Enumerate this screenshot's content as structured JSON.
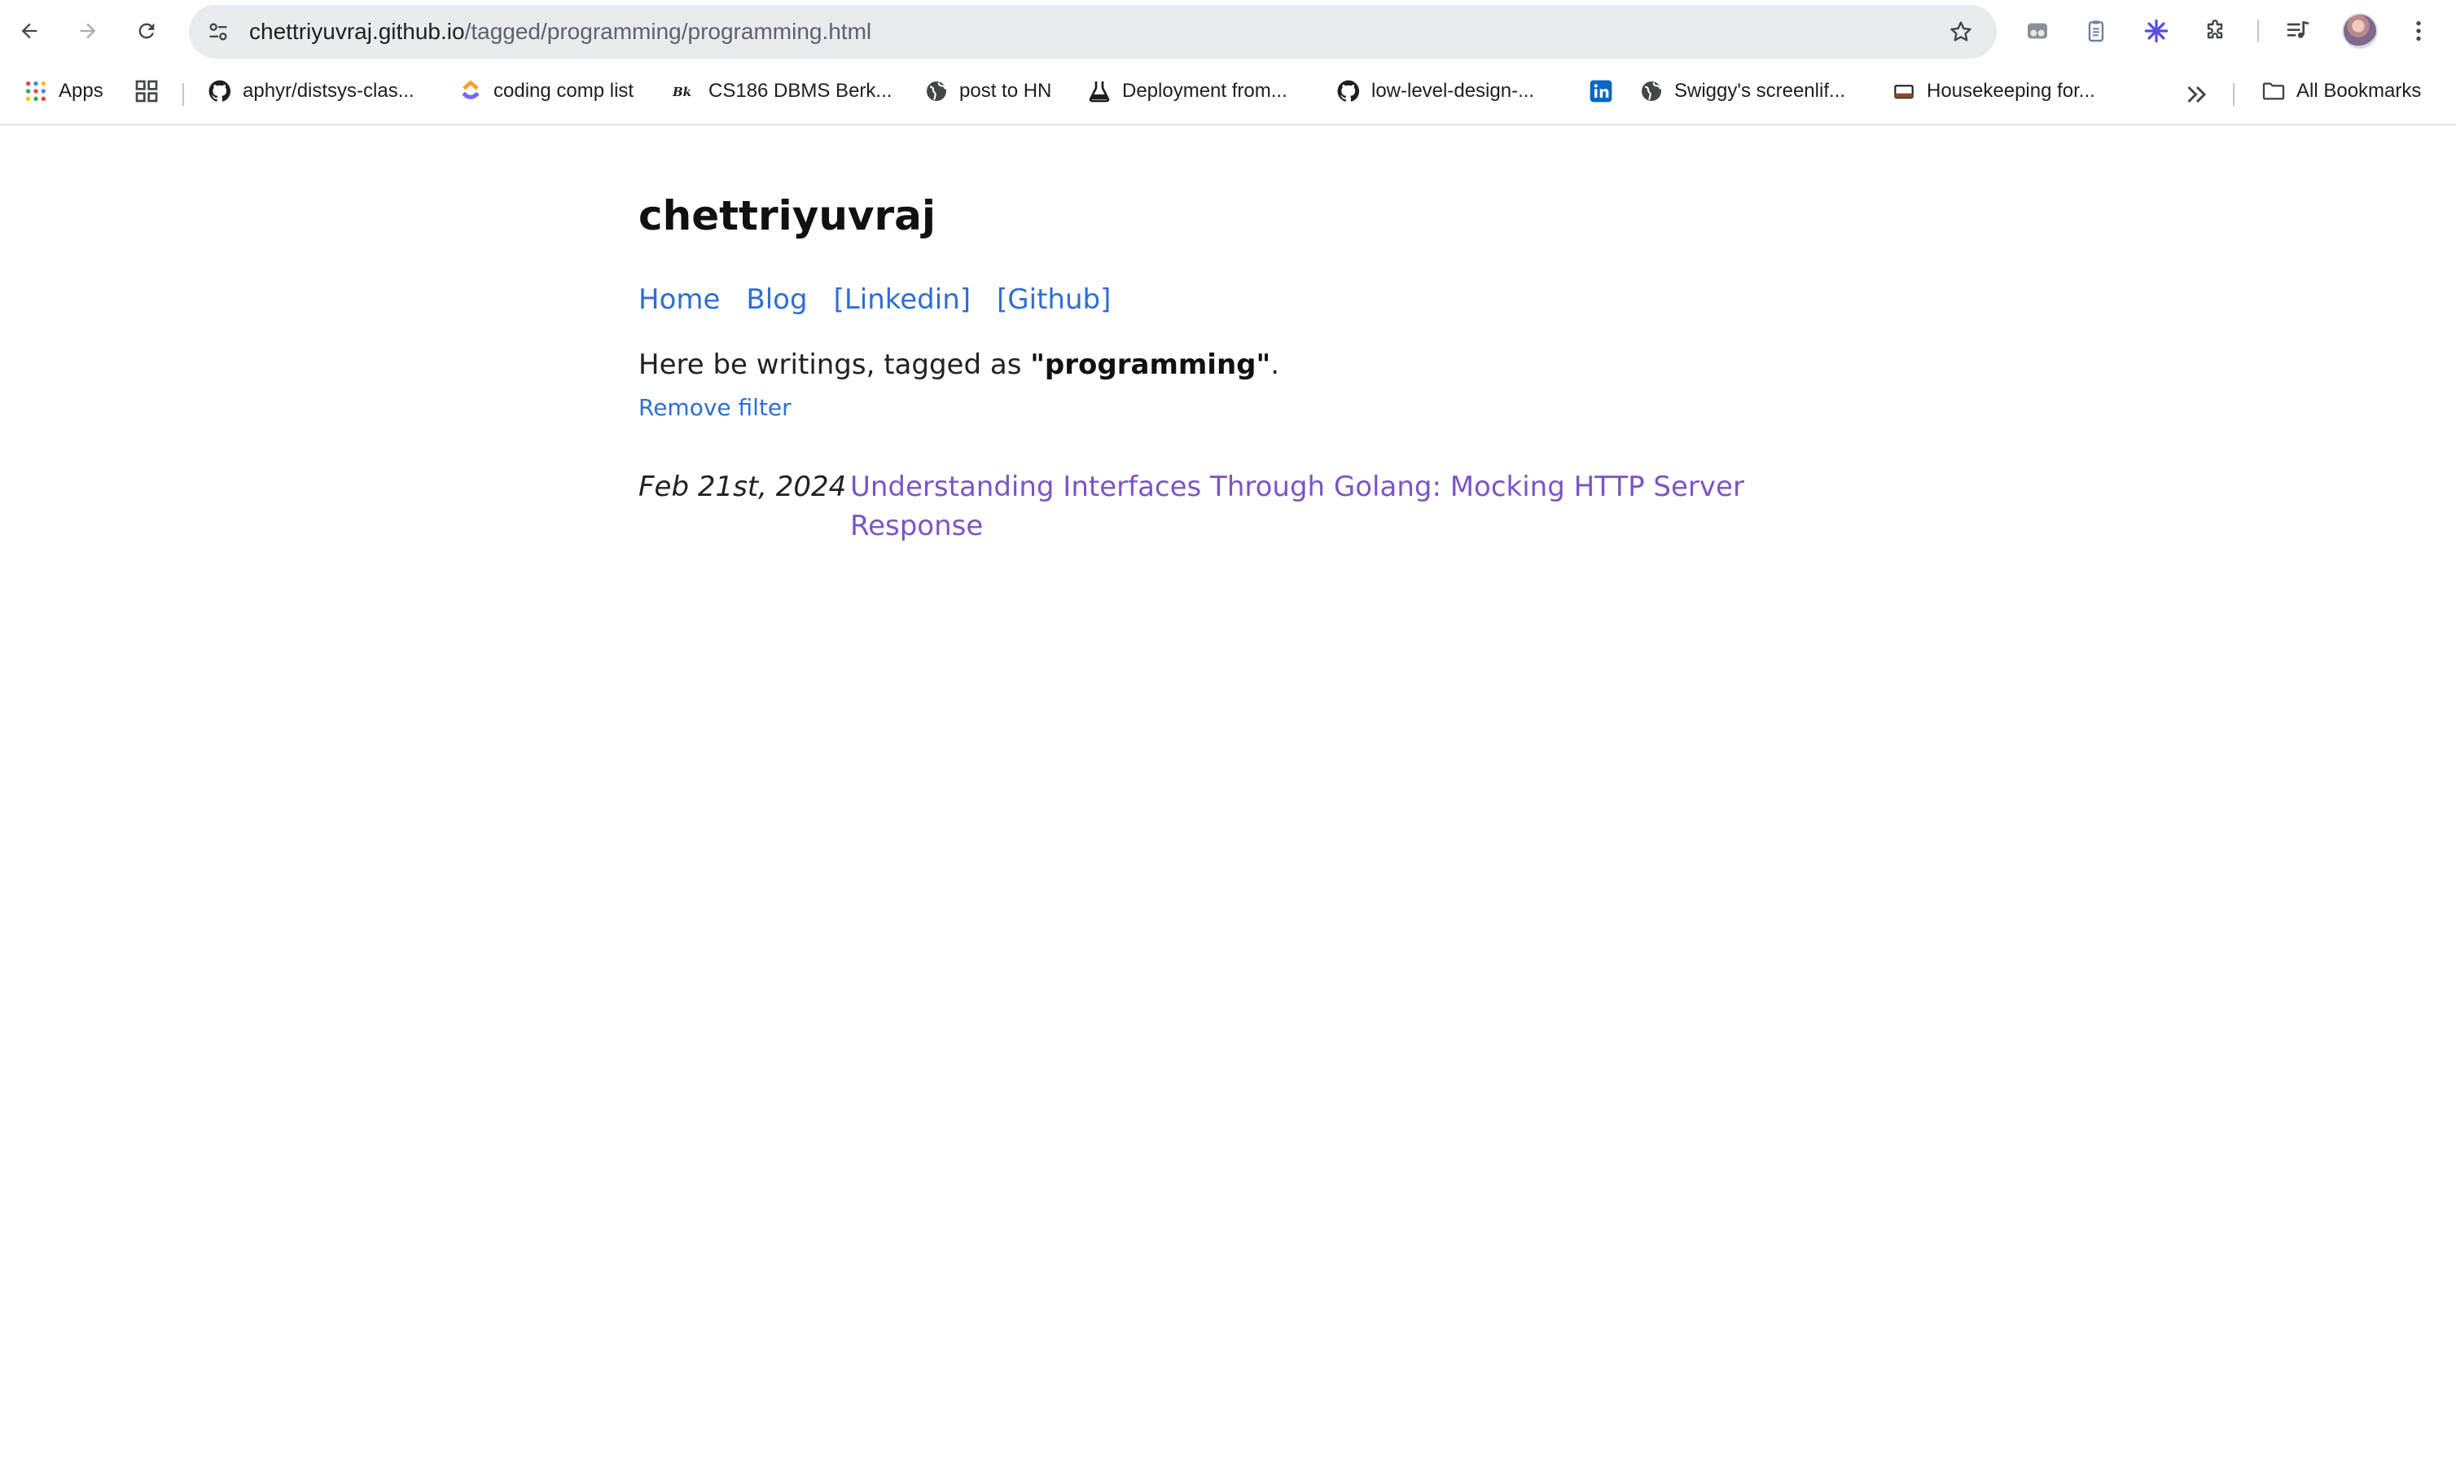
{
  "browser": {
    "url_host": "chettriyuvraj.github.io",
    "url_path": "/tagged/programming/programming.html"
  },
  "bookmarks": {
    "apps_label": "Apps",
    "items": [
      {
        "label": "aphyr/distsys-clas...",
        "icon": "github-icon"
      },
      {
        "label": "coding comp list",
        "icon": "clickup-icon"
      },
      {
        "label": "CS186 DBMS Berk...",
        "icon": "berkeley-icon"
      },
      {
        "label": "post to HN",
        "icon": "globe-icon"
      },
      {
        "label": "Deployment from...",
        "icon": "flask-icon"
      },
      {
        "label": "low-level-design-...",
        "icon": "github-icon"
      },
      {
        "label": "",
        "icon": "linkedin-icon"
      },
      {
        "label": "Swiggy's screenlif...",
        "icon": "globe-icon"
      },
      {
        "label": "Housekeeping for...",
        "icon": "page-icon"
      }
    ],
    "all_bookmarks_label": "All Bookmarks"
  },
  "page": {
    "site_title": "chettriyuvraj",
    "nav": {
      "home": "Home",
      "blog": "Blog",
      "linkedin": "[Linkedin]",
      "github": "[Github]"
    },
    "intro_prefix": "Here be writings, tagged as ",
    "tag": "\"programming\"",
    "intro_suffix": ".",
    "remove_filter": "Remove filter",
    "posts": [
      {
        "date": "Feb 21st, 2024",
        "title": "Understanding Interfaces Through Golang: Mocking HTTP Server Response"
      }
    ]
  },
  "colors": {
    "link": "#2f6ed3",
    "visited_link": "#7b55c5",
    "omnibox": "#e9ebee"
  }
}
